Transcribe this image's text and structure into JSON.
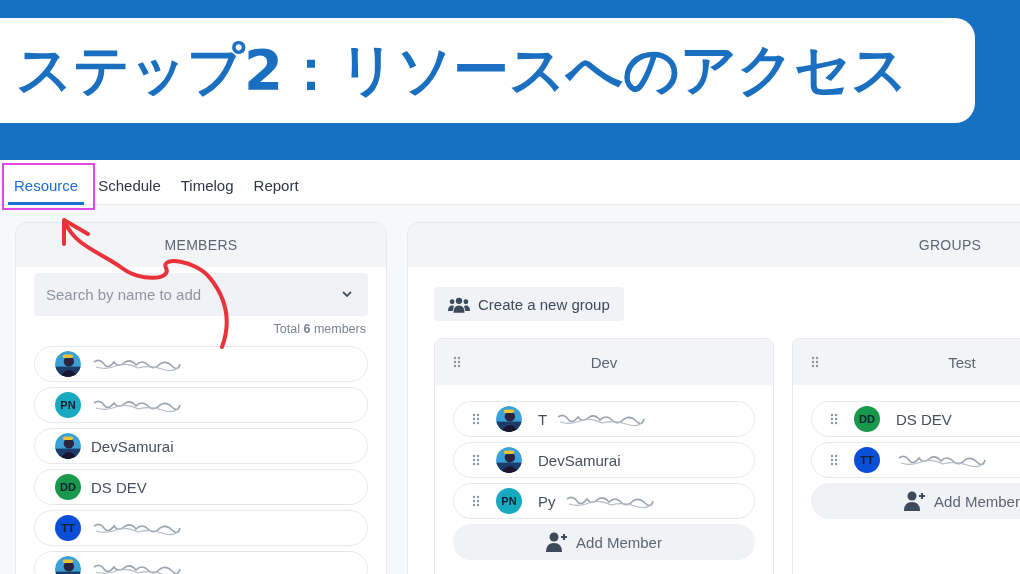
{
  "banner": {
    "title": "ステップ2：リソースへのアクセス"
  },
  "tabs": [
    {
      "label": "Resource",
      "selected": true
    },
    {
      "label": "Schedule",
      "selected": false
    },
    {
      "label": "Timelog",
      "selected": false
    },
    {
      "label": "Report",
      "selected": false
    }
  ],
  "members_panel": {
    "title": "MEMBERS",
    "search": {
      "placeholder": "Search by name to add"
    },
    "total": "Total **6** members",
    "members": [
      {
        "scribbled": true
      },
      {
        "avatar": {
          "kind": "initials",
          "initials": "PN",
          "color": "#17a9bf"
        },
        "scribbled": true
      },
      {
        "name": "DevSamurai",
        "scribbled": false
      },
      {
        "avatar": {
          "kind": "initials",
          "initials": "DD",
          "color": "#17984a"
        },
        "name": "DS DEV",
        "scribbled": false
      },
      {
        "avatar": {
          "kind": "initials",
          "initials": "TT",
          "color": "#0b4fd8"
        },
        "scribbled": true
      },
      {
        "scribbled": true
      }
    ]
  },
  "groups_panel": {
    "title": "GROUPS",
    "create_button": "Create a new group",
    "groups": [
      {
        "name": "Dev",
        "add_button": "Add Member",
        "members": [
          {
            "name": "T",
            "scribbled": true
          },
          {
            "name": "DevSamurai",
            "scribbled": false
          },
          {
            "avatar": {
              "kind": "initials",
              "initials": "PN",
              "color": "#17a9bf"
            },
            "name": "Py",
            "scribbled": true
          }
        ]
      },
      {
        "name": "Test",
        "add_button": "Add Member",
        "members": [
          {
            "avatar": {
              "kind": "initials",
              "initials": "DD",
              "color": "#17984a"
            },
            "name": "DS DEV",
            "scribbled": false
          },
          {
            "avatar": {
              "kind": "initials",
              "initials": "TT",
              "color": "#0b4fd8"
            },
            "scribbled": true
          }
        ]
      }
    ]
  }
}
